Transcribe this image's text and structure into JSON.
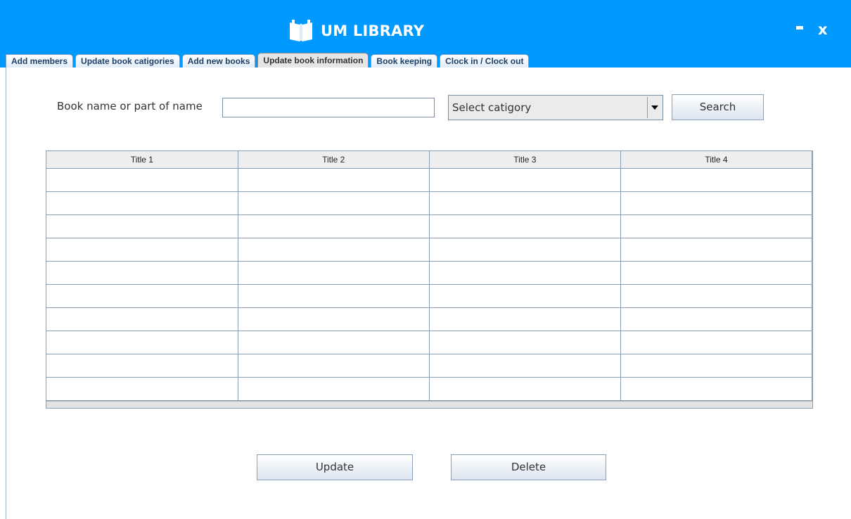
{
  "app": {
    "title": "UM LIBRARY",
    "logo_icon": "open-book-icon"
  },
  "window_controls": {
    "minimize_icon": "minimize-icon",
    "close_label": "x"
  },
  "tabs": [
    {
      "label": "Add members",
      "active": false
    },
    {
      "label": "Update book catigories",
      "active": false
    },
    {
      "label": "Add new books",
      "active": false
    },
    {
      "label": "Update book information",
      "active": true
    },
    {
      "label": "Book keeping",
      "active": false
    },
    {
      "label": "Clock in / Clock out",
      "active": false
    }
  ],
  "search": {
    "label": "Book name or part of name",
    "value": "",
    "category_value": "Select catigory",
    "button_label": "Search"
  },
  "table": {
    "columns": [
      "Title 1",
      "Title 2",
      "Title 3",
      "Title 4"
    ],
    "rows": [
      [
        "",
        "",
        "",
        ""
      ],
      [
        "",
        "",
        "",
        ""
      ],
      [
        "",
        "",
        "",
        ""
      ],
      [
        "",
        "",
        "",
        ""
      ],
      [
        "",
        "",
        "",
        ""
      ],
      [
        "",
        "",
        "",
        ""
      ],
      [
        "",
        "",
        "",
        ""
      ],
      [
        "",
        "",
        "",
        ""
      ],
      [
        "",
        "",
        "",
        ""
      ],
      [
        "",
        "",
        "",
        ""
      ]
    ]
  },
  "actions": {
    "update_label": "Update",
    "delete_label": "Delete"
  },
  "colors": {
    "header_bg": "#0099ff",
    "grid_line": "#8a9db5",
    "button_border": "#8aa1bd"
  }
}
